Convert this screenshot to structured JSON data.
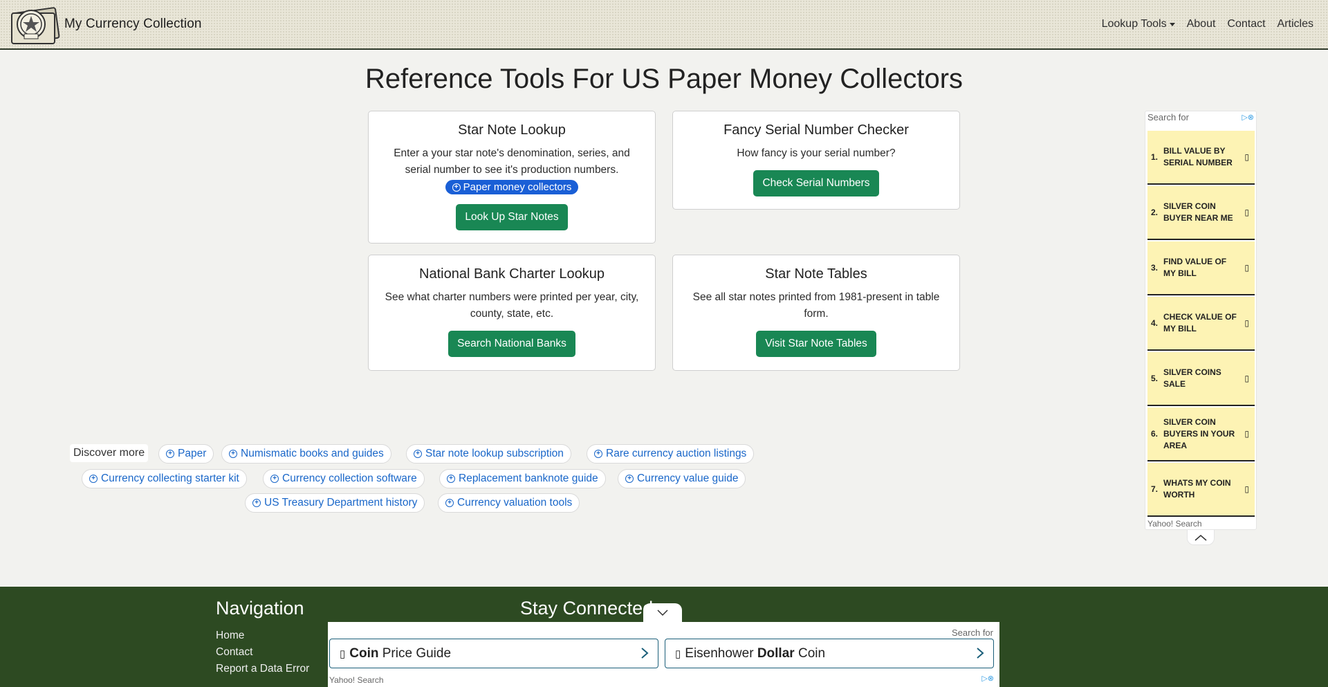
{
  "brand": {
    "name": "My Currency Collection",
    "logo_text": "$"
  },
  "nav": {
    "lookup_tools": "Lookup Tools",
    "about": "About",
    "contact": "Contact",
    "articles": "Articles"
  },
  "page_title": "Reference Tools For US Paper Money Collectors",
  "cards": [
    {
      "title": "Star Note Lookup",
      "desc": "Enter a your star note's denomination, series, and serial number to see it's production numbers.",
      "pill": "Paper money collectors",
      "button": "Look Up Star Notes"
    },
    {
      "title": "Fancy Serial Number Checker",
      "desc": "How fancy is your serial number?",
      "button": "Check Serial Numbers"
    },
    {
      "title": "National Bank Charter Lookup",
      "desc": "See what charter numbers were printed per year, city, county, state, etc.",
      "button": "Search National Banks"
    },
    {
      "title": "Star Note Tables",
      "desc": "See all star notes printed from 1981-present in table form.",
      "button": "Visit Star Note Tables"
    }
  ],
  "discover": {
    "label": "Discover more",
    "chips": [
      "Paper",
      "Numismatic books and guides",
      "Star note lookup subscription",
      "Rare currency auction listings",
      "Currency collecting starter kit",
      "Currency collection software",
      "Replacement banknote guide",
      "Currency value guide",
      "US Treasury Department history",
      "Currency valuation tools"
    ]
  },
  "side_ad": {
    "search_for": "Search for",
    "items": [
      {
        "num": "1.",
        "text": "BILL VALUE BY SERIAL NUMBER"
      },
      {
        "num": "2.",
        "text": "SILVER COIN BUYER NEAR ME"
      },
      {
        "num": "3.",
        "text": "FIND VALUE OF MY BILL"
      },
      {
        "num": "4.",
        "text": "CHECK VALUE OF MY BILL"
      },
      {
        "num": "5.",
        "text": "SILVER COINS SALE"
      },
      {
        "num": "6.",
        "text": "SILVER COIN BUYERS IN YOUR AREA"
      },
      {
        "num": "7.",
        "text": "WHATS MY COIN WORTH"
      }
    ],
    "footer": "Yahoo! Search"
  },
  "footer": {
    "nav_title": "Navigation",
    "links": [
      "Home",
      "Contact",
      "Report a Data Error"
    ],
    "stay_title": "Stay Connected"
  },
  "bottom_ad": {
    "search_for": "Search for",
    "items": [
      {
        "bold": "Coin",
        "rest": " Price Guide"
      },
      {
        "pre": "Eisenhower ",
        "bold": "Dollar",
        "rest": " Coin"
      }
    ],
    "footer": "Yahoo! Search"
  },
  "colors": {
    "green_button": "#198754",
    "pill_blue": "#1a5fd6",
    "link_blue": "#1a67c9",
    "footer_green": "#2d4a22",
    "ad_yellow": "#fdf3b4"
  }
}
